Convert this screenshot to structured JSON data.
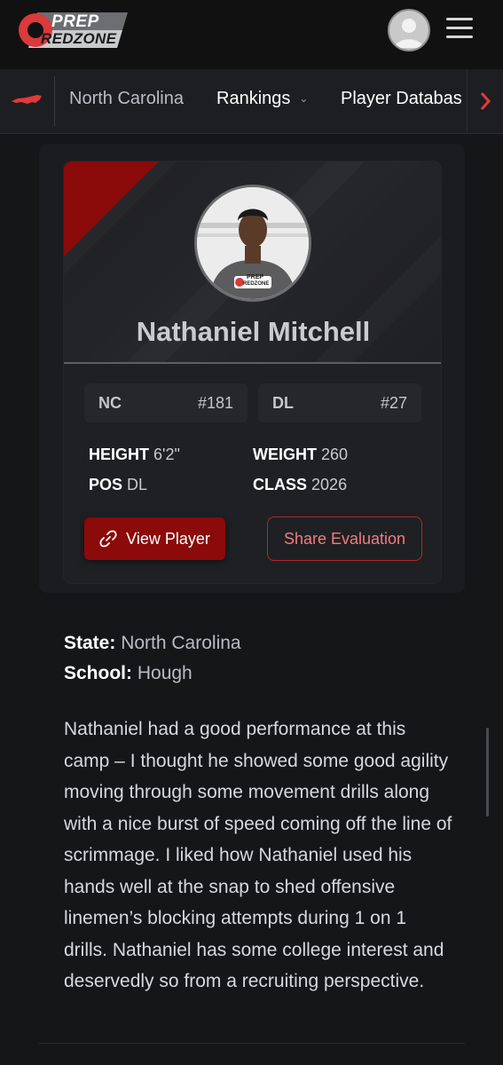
{
  "header": {
    "logo_top": "PREP",
    "logo_bottom": "REDZONE"
  },
  "nav": {
    "state": "North Carolina",
    "rankings": "Rankings",
    "rankings_chevron": "⌄",
    "database": "Player Databas"
  },
  "player": {
    "name": "Nathaniel Mitchell",
    "photo_logo_top": "PREP",
    "photo_logo_bottom": "REDZONE",
    "state_abbr": "NC",
    "state_rank": "#181",
    "position_abbr": "DL",
    "position_rank": "#27",
    "height_label": "HEIGHT",
    "height_value": "6'2\"",
    "weight_label": "WEIGHT",
    "weight_value": "260",
    "pos_label": "POS",
    "pos_value": "DL",
    "class_label": "CLASS",
    "class_value": "2026",
    "view_button": "View Player",
    "share_button": "Share Evaluation"
  },
  "details": {
    "state_label": "State:",
    "state_value": "North Carolina",
    "school_label": "School:",
    "school_value": "Hough",
    "evaluation": "Nathaniel had a good performance at this camp – I thought he showed some good agility moving through some movement drills along with a nice burst of speed coming off the line of scrimmage. I liked how Nathaniel used his hands well at the snap to shed offensive linemen’s blocking attempts during 1 on 1 drills. Nathaniel has some college interest and deservedly so from a recruiting perspective."
  },
  "colors": {
    "brand_red": "#8b0a0a",
    "accent_red": "#e23a3c",
    "background": "#151618"
  },
  "icons": {
    "menu": "hamburger-icon",
    "user": "user-avatar-icon",
    "next": "chevron-right-icon",
    "link": "link-icon",
    "state": "north-carolina-map-icon"
  }
}
